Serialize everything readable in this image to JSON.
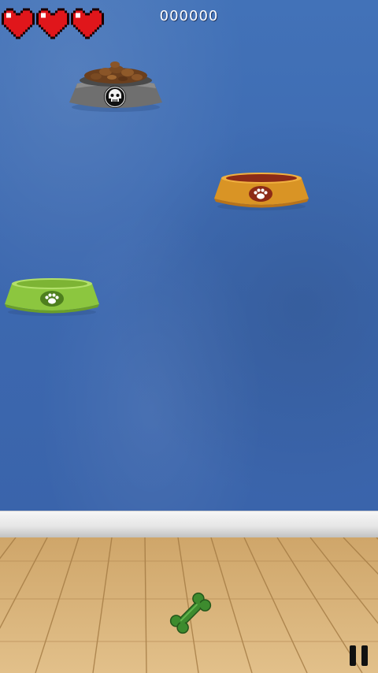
{
  "hud": {
    "lives": 3,
    "score": "000000",
    "heart_icon": "heart-icon",
    "heart_color": "#e0161b"
  },
  "bowls": [
    {
      "kind": "food-bowl",
      "color": "#6f6f6f",
      "emblem": "skull-icon",
      "filled": true
    },
    {
      "kind": "orange-bowl",
      "color": "#d99425",
      "emblem": "paw-icon",
      "filled": false
    },
    {
      "kind": "green-bowl",
      "color": "#8cc63f",
      "emblem": "paw-icon",
      "filled": false
    }
  ],
  "player": {
    "icon": "bone-icon",
    "color": "#3d8b2e"
  },
  "controls": {
    "pause_icon": "pause-icon"
  },
  "colors": {
    "wall": "#3d69b0",
    "floor": "#d9b47a",
    "baseboard": "#eeeeee"
  }
}
